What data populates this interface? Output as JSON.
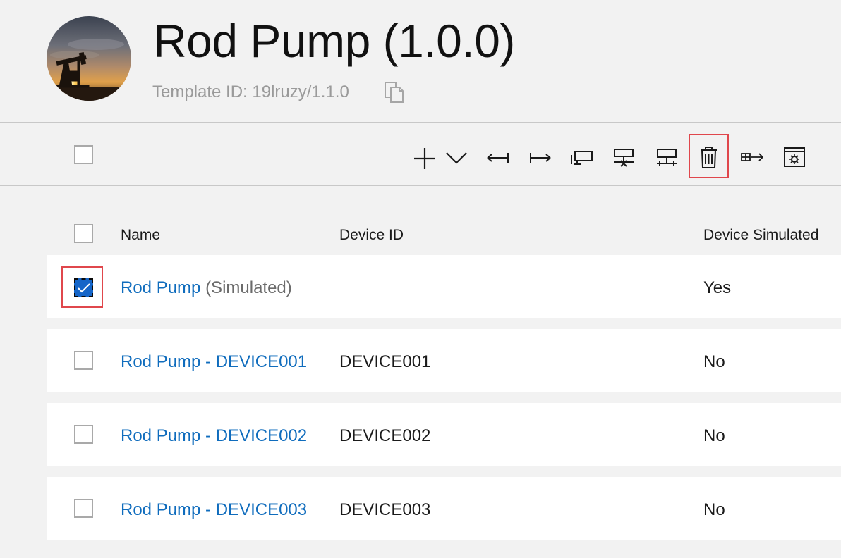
{
  "header": {
    "title": "Rod Pump (1.0.0)",
    "template_id": "Template ID: 19lruzy/1.1.0",
    "avatar_icon": "oil-pump-sunset-photo",
    "copy_icon": "copy-icon"
  },
  "toolbar": {
    "icons": [
      "add-icon",
      "chevron-down-icon",
      "import-icon",
      "export-icon",
      "device-connect-icon",
      "device-block-icon",
      "network-device-icon",
      "delete-icon",
      "migrate-icon",
      "settings-window-icon"
    ],
    "highlighted": "delete-icon"
  },
  "table": {
    "columns": [
      "Name",
      "Device ID",
      "Device Simulated"
    ],
    "rows": [
      {
        "name": "Rod Pump",
        "suffix": "(Simulated)",
        "device_id": "",
        "simulated": "Yes",
        "checked": true
      },
      {
        "name": "Rod Pump - DEVICE001",
        "suffix": "",
        "device_id": "DEVICE001",
        "simulated": "No",
        "checked": false
      },
      {
        "name": "Rod Pump - DEVICE002",
        "suffix": "",
        "device_id": "DEVICE002",
        "simulated": "No",
        "checked": false
      },
      {
        "name": "Rod Pump - DEVICE003",
        "suffix": "",
        "device_id": "DEVICE003",
        "simulated": "No",
        "checked": false
      }
    ]
  },
  "colors": {
    "link": "#0f6cbd",
    "checked_fill": "#1565c8",
    "highlight": "#e0474c",
    "background": "#f2f2f2"
  }
}
